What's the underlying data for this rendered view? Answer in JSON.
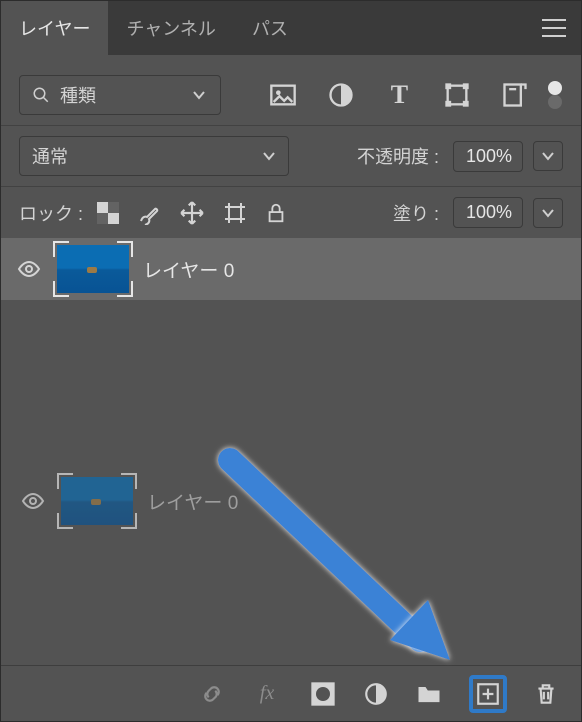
{
  "tabs": {
    "layers": "レイヤー",
    "channels": "チャンネル",
    "paths": "パス"
  },
  "filter": {
    "label": "種類"
  },
  "blend": {
    "mode": "通常",
    "opacity_label": "不透明度 :",
    "opacity_value": "100%"
  },
  "lock": {
    "label": "ロック :",
    "fill_label": "塗り :",
    "fill_value": "100%"
  },
  "layers": [
    {
      "name": "レイヤー 0"
    },
    {
      "name": "レイヤー 0"
    }
  ],
  "icons": {
    "search": "search-icon",
    "image": "image-icon",
    "adjust": "adjust-icon",
    "text": "T",
    "shape": "shape-icon",
    "smart": "smart-icon",
    "pixels": "pixels-icon",
    "brush": "brush-icon",
    "move": "move-icon",
    "crop": "crop-icon",
    "lockicon": "lock-icon",
    "link": "link-icon",
    "fx": "fx",
    "mask": "mask-icon",
    "adjustlayer": "adjust-icon",
    "group": "folder-icon",
    "new": "new-icon",
    "trash": "trash-icon"
  }
}
